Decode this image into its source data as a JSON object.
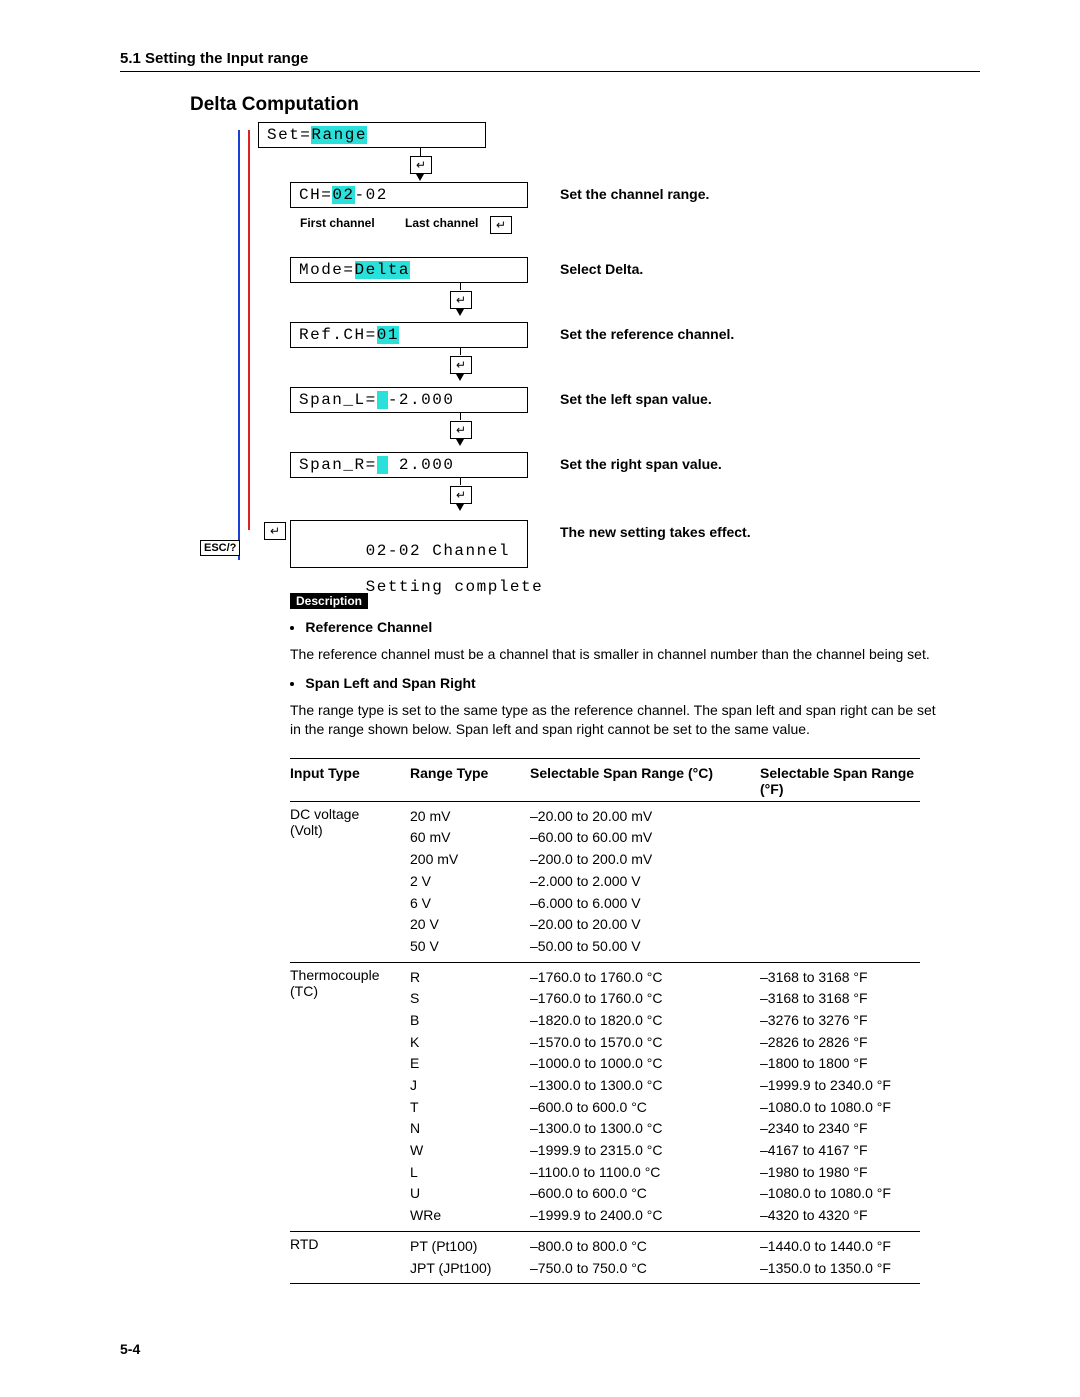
{
  "header": "5.1  Setting the Input range",
  "title": "Delta Computation",
  "page_num": "5-4",
  "esc_label": "ESC/?",
  "steps": [
    {
      "prefix": "Set=",
      "hl": "Range",
      "suffix": "",
      "note": "",
      "sub1": "",
      "sub2": ""
    },
    {
      "prefix": "CH=",
      "hl": "02",
      "suffix": "-02",
      "note": "Set the channel range.",
      "sub1": "First channel",
      "sub2": "Last channel"
    },
    {
      "prefix": "Mode=",
      "hl": "Delta",
      "suffix": "",
      "note": "Select Delta.",
      "sub1": "",
      "sub2": ""
    },
    {
      "prefix": "Ref.CH=",
      "hl": "01",
      "suffix": "",
      "note": "Set the reference channel.",
      "sub1": "",
      "sub2": ""
    },
    {
      "prefix": "Span_L=",
      "hl": " ",
      "suffix": "-2.000",
      "note": "Set the left span value.",
      "sub1": "",
      "sub2": ""
    },
    {
      "prefix": "Span_R=",
      "hl": " ",
      "suffix": " 2.000",
      "note": "Set the right span value.",
      "sub1": "",
      "sub2": ""
    }
  ],
  "final_line1": "02-02 Channel",
  "final_line2": "Setting complete",
  "final_note": "The new setting takes effect.",
  "desc_tag": "Description",
  "desc": {
    "ref_title": "Reference Channel",
    "ref_body": "The reference channel must be a channel that is smaller in channel number than the channel being set.",
    "span_title": "Span Left and Span Right",
    "span_body": "The range type is set to the same type as the reference channel.  The span left and span right can be set in the range shown below.  Span left and span right cannot be set to the same value."
  },
  "table": {
    "headers": {
      "it": "Input Type",
      "rt": "Range Type",
      "c": "Selectable Span Range (°C)",
      "f": "Selectable Span Range (°F)"
    },
    "groups": [
      {
        "it": "DC voltage (Volt)",
        "rows": [
          {
            "rt": "20 mV",
            "c": "–20.00 to 20.00 mV",
            "f": ""
          },
          {
            "rt": "60 mV",
            "c": "–60.00 to 60.00 mV",
            "f": ""
          },
          {
            "rt": "200 mV",
            "c": "–200.0 to 200.0 mV",
            "f": ""
          },
          {
            "rt": "2 V",
            "c": "–2.000 to 2.000 V",
            "f": ""
          },
          {
            "rt": "6 V",
            "c": "–6.000 to 6.000 V",
            "f": ""
          },
          {
            "rt": "20 V",
            "c": "–20.00 to 20.00 V",
            "f": ""
          },
          {
            "rt": "50 V",
            "c": "–50.00 to 50.00 V",
            "f": ""
          }
        ]
      },
      {
        "it": "Thermocouple (TC)",
        "rows": [
          {
            "rt": "R",
            "c": "–1760.0 to 1760.0 °C",
            "f": "–3168 to 3168 °F"
          },
          {
            "rt": "S",
            "c": "–1760.0 to 1760.0 °C",
            "f": "–3168 to 3168 °F"
          },
          {
            "rt": "B",
            "c": "–1820.0 to 1820.0 °C",
            "f": "–3276 to 3276 °F"
          },
          {
            "rt": "K",
            "c": "–1570.0 to 1570.0 °C",
            "f": "–2826 to 2826 °F"
          },
          {
            "rt": "E",
            "c": "–1000.0 to 1000.0 °C",
            "f": "–1800 to 1800 °F"
          },
          {
            "rt": "J",
            "c": "–1300.0 to 1300.0 °C",
            "f": "–1999.9 to 2340.0 °F"
          },
          {
            "rt": "T",
            "c": "–600.0 to 600.0 °C",
            "f": "–1080.0 to 1080.0 °F"
          },
          {
            "rt": "N",
            "c": "–1300.0 to 1300.0 °C",
            "f": "–2340 to 2340 °F"
          },
          {
            "rt": "W",
            "c": "–1999.9 to 2315.0 °C",
            "f": "–4167 to 4167 °F"
          },
          {
            "rt": "L",
            "c": "–1100.0 to 1100.0 °C",
            "f": "–1980 to 1980 °F"
          },
          {
            "rt": "U",
            "c": "–600.0 to 600.0 °C",
            "f": "–1080.0 to 1080.0 °F"
          },
          {
            "rt": "WRe",
            "c": "–1999.9 to 2400.0 °C",
            "f": "–4320 to 4320 °F"
          }
        ]
      },
      {
        "it": "RTD",
        "rows": [
          {
            "rt": "PT (Pt100)",
            "c": "–800.0 to 800.0 °C",
            "f": "–1440.0 to 1440.0 °F"
          },
          {
            "rt": "JPT (JPt100)",
            "c": "–750.0 to 750.0 °C",
            "f": "–1350.0 to 1350.0 °F"
          }
        ]
      }
    ]
  }
}
